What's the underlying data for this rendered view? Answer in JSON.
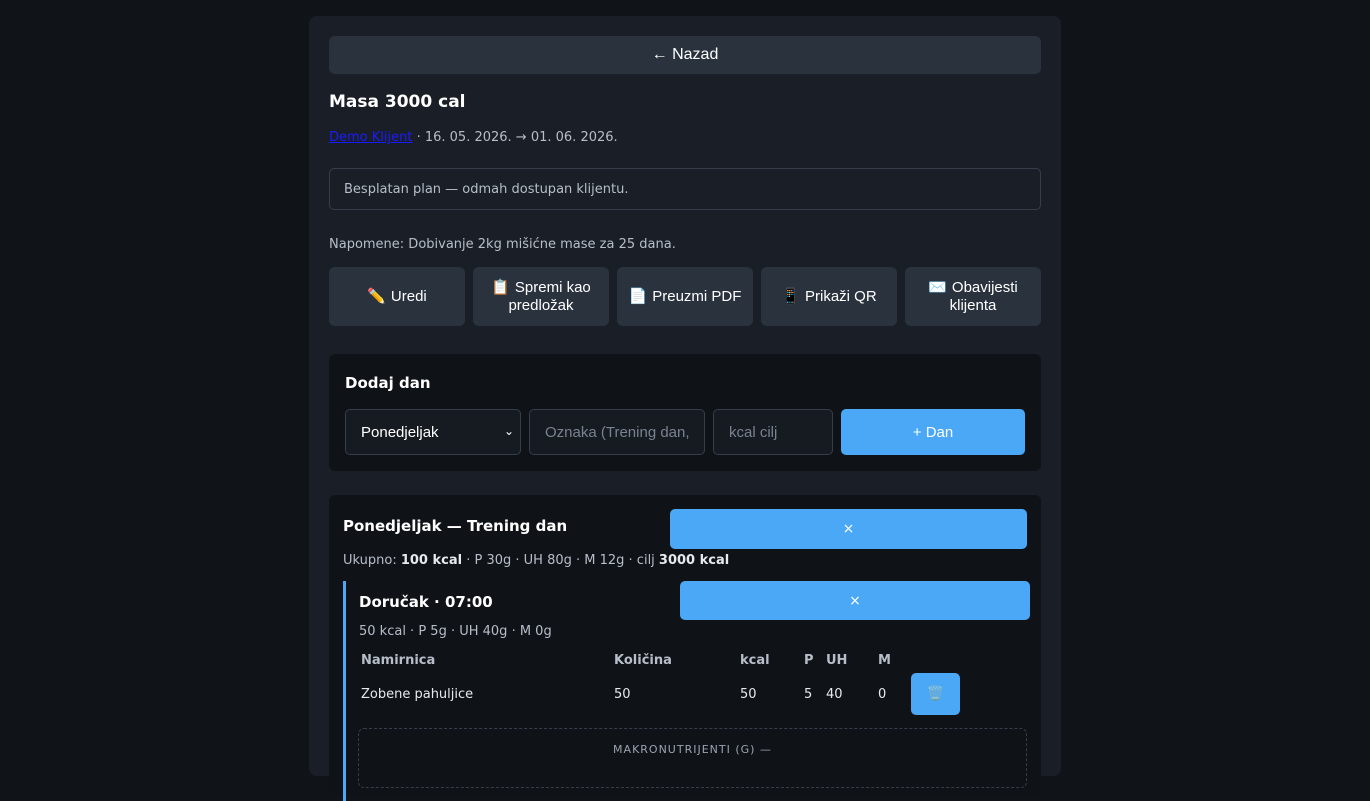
{
  "nav": {
    "back_label": "← Nazad"
  },
  "plan": {
    "title": "Masa 3000 cal",
    "client_link": "Demo Klijent",
    "dates": " · 16. 05. 2026. → 01. 06. 2026.",
    "notice": "Besplatan plan — odmah dostupan klijentu.",
    "notes": "Napomene: Dobivanje 2kg mišićne mase za 25 dana."
  },
  "actions": [
    {
      "icon": "✏️",
      "label": "Uredi"
    },
    {
      "icon": "📋",
      "label": "Spremi kao predložak"
    },
    {
      "icon": "📄",
      "label": "Preuzmi PDF"
    },
    {
      "icon": "📱",
      "label": "Prikaži QR"
    },
    {
      "icon": "✉️",
      "label": "Obavijesti klijenta"
    }
  ],
  "add_day": {
    "title": "Dodaj dan",
    "day_select_value": "Ponedjeljak",
    "label_placeholder": "Oznaka (Trening dan,",
    "kcal_placeholder": "kcal cilj",
    "add_button": "+ Dan"
  },
  "day": {
    "title": "Ponedjeljak — Trening dan",
    "remove_label": "×",
    "total_prefix": "Ukupno: ",
    "total_kcal": "100 kcal",
    "total_macros": " · P 30g · UH 80g · M 12g · cilj ",
    "goal_kcal": "3000 kcal",
    "meal": {
      "title": "Doručak · 07:00",
      "remove_label": "×",
      "summary": "50 kcal · P 5g · UH 40g · M 0g",
      "columns": [
        "Namirnica",
        "Količina",
        "kcal",
        "P",
        "UH",
        "M"
      ],
      "rows": [
        {
          "food": "Zobene pahuljice",
          "amount": "50",
          "kcal": "50",
          "p": "5",
          "uh": "40",
          "m": "0",
          "delete_icon": "🗑️"
        }
      ],
      "macro_section_label": "MAKRONUTRIJENTI (G) —"
    }
  },
  "colors": {
    "accent": "#4aa8f6",
    "panel": "#1a1f27",
    "card": "#0f1318"
  }
}
